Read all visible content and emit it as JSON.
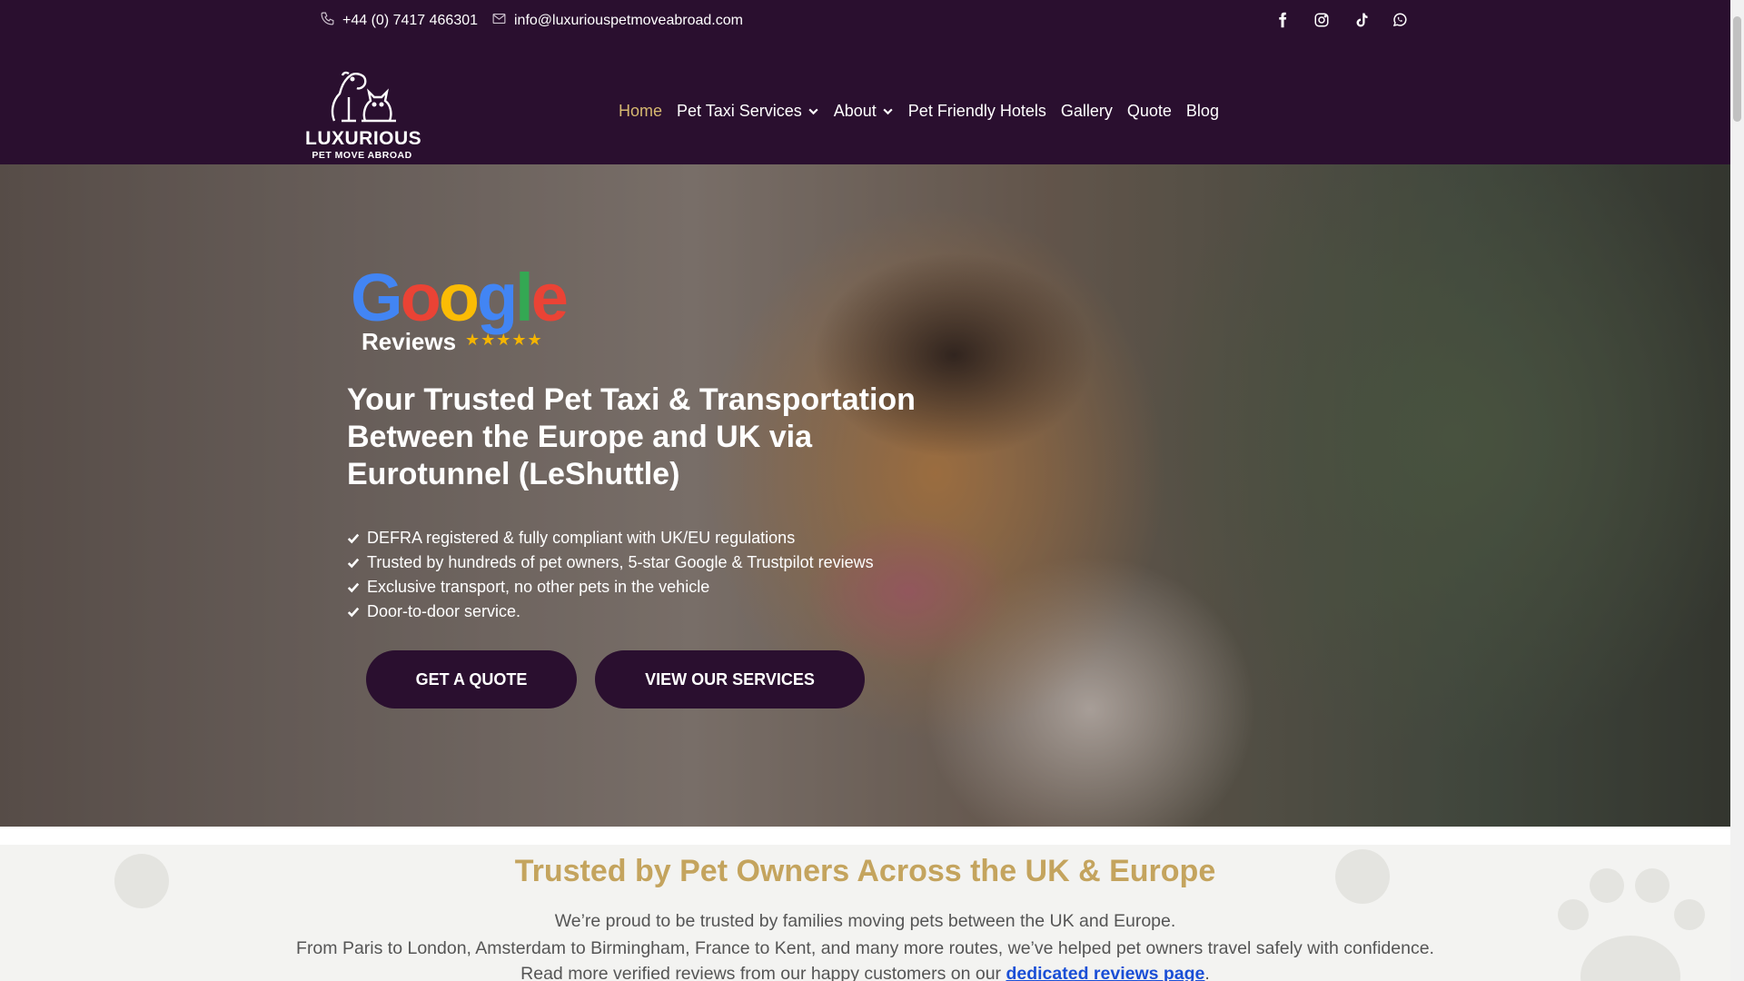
{
  "topbar": {
    "phone": "+44 (0) 7417 466301",
    "email": "info@luxuriouspetmoveabroad.com",
    "socials": [
      "facebook-icon",
      "instagram-icon",
      "tiktok-icon",
      "whatsapp-icon"
    ]
  },
  "logo": {
    "title": "LUXURIOUS",
    "subtitle": "PET MOVE ABROAD"
  },
  "nav": {
    "items": [
      {
        "label": "Home",
        "active": true
      },
      {
        "label": "Pet Taxi Services",
        "dropdown": true
      },
      {
        "label": "About",
        "dropdown": true
      },
      {
        "label": "Pet Friendly Hotels"
      },
      {
        "label": "Gallery"
      },
      {
        "label": "Quote"
      },
      {
        "label": "Blog"
      }
    ]
  },
  "hero": {
    "google": {
      "word": "Google",
      "label": "Reviews",
      "stars": "★★★★★"
    },
    "headline": "Your Trusted Pet Taxi & Transportation Between the Europe and UK via Eurotunnel (LeShuttle)",
    "features": [
      "DEFRA registered & fully compliant with UK/EU regulations",
      "Trusted by hundreds of pet owners, 5-star Google & Trustpilot reviews",
      "Exclusive transport, no other pets in the vehicle",
      "Door-to-door service."
    ],
    "cta_quote": "GET A QUOTE",
    "cta_services": "VIEW OUR SERVICES"
  },
  "trusted": {
    "title": "Trusted by Pet Owners Across the UK & Europe",
    "line1": "We’re proud to be trusted by families moving pets between the UK and Europe.",
    "line2": "From Paris to London, Amsterdam to Birmingham, France to Kent, and many more routes, we’ve helped pet owners travel safely with confidence.",
    "line3_prefix": "Read more verified reviews from our happy customers on our",
    "line3_link": "dedicated reviews page",
    "line3_suffix": "."
  },
  "colors": {
    "brand_dark": "#2a0f2f",
    "nav_active": "#d6b870",
    "trusted_title": "#c4a45e",
    "link": "#1a4fd6"
  }
}
